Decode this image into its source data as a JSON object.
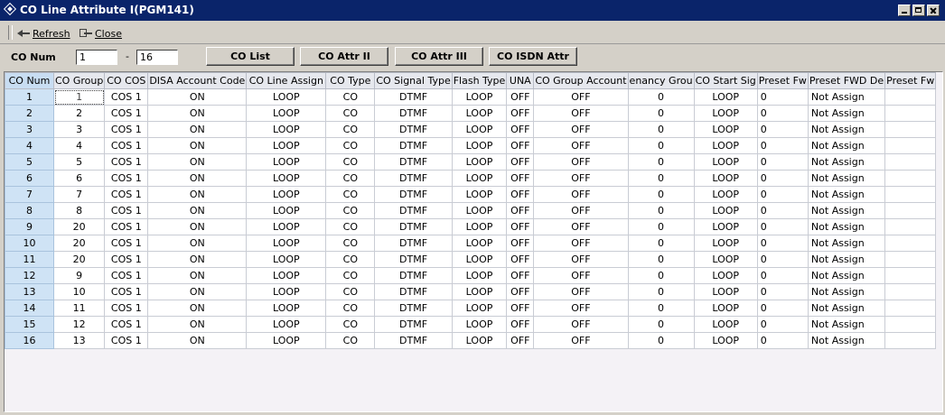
{
  "window": {
    "title": "CO Line Attribute I(PGM141)"
  },
  "toolbar": {
    "refresh_label": "Refresh",
    "close_label": "Close"
  },
  "filter": {
    "label": "CO Num",
    "from": "1",
    "separator": "-",
    "to": "16"
  },
  "buttons": {
    "co_list": "CO List",
    "co_attr_ii": "CO Attr II",
    "co_attr_iii": "CO Attr III",
    "co_isdn_attr": "CO ISDN Attr"
  },
  "table": {
    "headers": [
      "CO Num",
      "CO Group",
      "CO COS",
      "DISA Account Code",
      "CO Line Assign",
      "CO Type",
      "CO Signal Type",
      "Flash Type",
      "UNA",
      "CO Group Account",
      "enancy Grou",
      "CO Start Sig",
      "Preset Fw",
      "Preset FWD De",
      "Preset Fw"
    ],
    "rows": [
      [
        "1",
        "1",
        "COS 1",
        "ON",
        "LOOP",
        "CO",
        "DTMF",
        "LOOP",
        "OFF",
        "OFF",
        "0",
        "LOOP",
        "0",
        "Not Assign",
        ""
      ],
      [
        "2",
        "2",
        "COS 1",
        "ON",
        "LOOP",
        "CO",
        "DTMF",
        "LOOP",
        "OFF",
        "OFF",
        "0",
        "LOOP",
        "0",
        "Not Assign",
        ""
      ],
      [
        "3",
        "3",
        "COS 1",
        "ON",
        "LOOP",
        "CO",
        "DTMF",
        "LOOP",
        "OFF",
        "OFF",
        "0",
        "LOOP",
        "0",
        "Not Assign",
        ""
      ],
      [
        "4",
        "4",
        "COS 1",
        "ON",
        "LOOP",
        "CO",
        "DTMF",
        "LOOP",
        "OFF",
        "OFF",
        "0",
        "LOOP",
        "0",
        "Not Assign",
        ""
      ],
      [
        "5",
        "5",
        "COS 1",
        "ON",
        "LOOP",
        "CO",
        "DTMF",
        "LOOP",
        "OFF",
        "OFF",
        "0",
        "LOOP",
        "0",
        "Not Assign",
        ""
      ],
      [
        "6",
        "6",
        "COS 1",
        "ON",
        "LOOP",
        "CO",
        "DTMF",
        "LOOP",
        "OFF",
        "OFF",
        "0",
        "LOOP",
        "0",
        "Not Assign",
        ""
      ],
      [
        "7",
        "7",
        "COS 1",
        "ON",
        "LOOP",
        "CO",
        "DTMF",
        "LOOP",
        "OFF",
        "OFF",
        "0",
        "LOOP",
        "0",
        "Not Assign",
        ""
      ],
      [
        "8",
        "8",
        "COS 1",
        "ON",
        "LOOP",
        "CO",
        "DTMF",
        "LOOP",
        "OFF",
        "OFF",
        "0",
        "LOOP",
        "0",
        "Not Assign",
        ""
      ],
      [
        "9",
        "20",
        "COS 1",
        "ON",
        "LOOP",
        "CO",
        "DTMF",
        "LOOP",
        "OFF",
        "OFF",
        "0",
        "LOOP",
        "0",
        "Not Assign",
        ""
      ],
      [
        "10",
        "20",
        "COS 1",
        "ON",
        "LOOP",
        "CO",
        "DTMF",
        "LOOP",
        "OFF",
        "OFF",
        "0",
        "LOOP",
        "0",
        "Not Assign",
        ""
      ],
      [
        "11",
        "20",
        "COS 1",
        "ON",
        "LOOP",
        "CO",
        "DTMF",
        "LOOP",
        "OFF",
        "OFF",
        "0",
        "LOOP",
        "0",
        "Not Assign",
        ""
      ],
      [
        "12",
        "9",
        "COS 1",
        "ON",
        "LOOP",
        "CO",
        "DTMF",
        "LOOP",
        "OFF",
        "OFF",
        "0",
        "LOOP",
        "0",
        "Not Assign",
        ""
      ],
      [
        "13",
        "10",
        "COS 1",
        "ON",
        "LOOP",
        "CO",
        "DTMF",
        "LOOP",
        "OFF",
        "OFF",
        "0",
        "LOOP",
        "0",
        "Not Assign",
        ""
      ],
      [
        "14",
        "11",
        "COS 1",
        "ON",
        "LOOP",
        "CO",
        "DTMF",
        "LOOP",
        "OFF",
        "OFF",
        "0",
        "LOOP",
        "0",
        "Not Assign",
        ""
      ],
      [
        "15",
        "12",
        "COS 1",
        "ON",
        "LOOP",
        "CO",
        "DTMF",
        "LOOP",
        "OFF",
        "OFF",
        "0",
        "LOOP",
        "0",
        "Not Assign",
        ""
      ],
      [
        "16",
        "13",
        "COS 1",
        "ON",
        "LOOP",
        "CO",
        "DTMF",
        "LOOP",
        "OFF",
        "OFF",
        "0",
        "LOOP",
        "0",
        "Not Assign",
        ""
      ]
    ]
  }
}
